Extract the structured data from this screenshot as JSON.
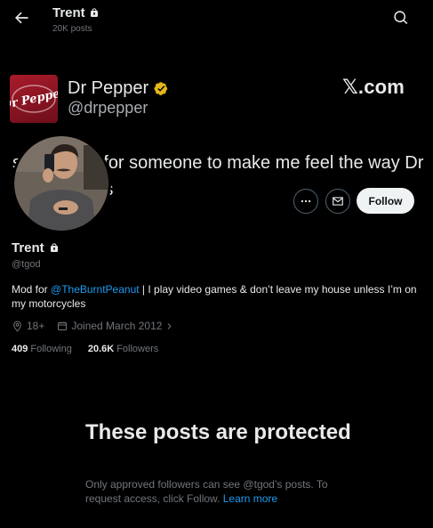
{
  "header": {
    "title": "Trent",
    "post_count": "20K posts"
  },
  "banner": {
    "brand_name": "Dr Pepper",
    "brand_handle": "@drpepper",
    "site": "𝕏.com",
    "tweet_text": "still waiting for someone to make me feel the way Dr Pepper does",
    "logo_text": "Dr Pepper"
  },
  "profile": {
    "name": "Trent",
    "handle": "@tgod",
    "bio_prefix": "Mod for ",
    "bio_mention": "@TheBurntPeanut",
    "bio_suffix": " | I play video games & don’t leave my house unless I’m on my motorcycles",
    "location": "18+",
    "joined": "Joined March 2012",
    "following_count": "409",
    "following_label": "Following",
    "followers_count": "20.6K",
    "followers_label": "Followers"
  },
  "actions": {
    "follow_label": "Follow"
  },
  "protected": {
    "title": "These posts are protected",
    "body": "Only approved followers can see @tgod’s posts. To request access, click Follow.",
    "link": "Learn more"
  },
  "colors": {
    "background": "#000000",
    "accent": "#1d9bf0",
    "verified_gold": "#e2b719",
    "brand_red": "#a91b2b"
  }
}
